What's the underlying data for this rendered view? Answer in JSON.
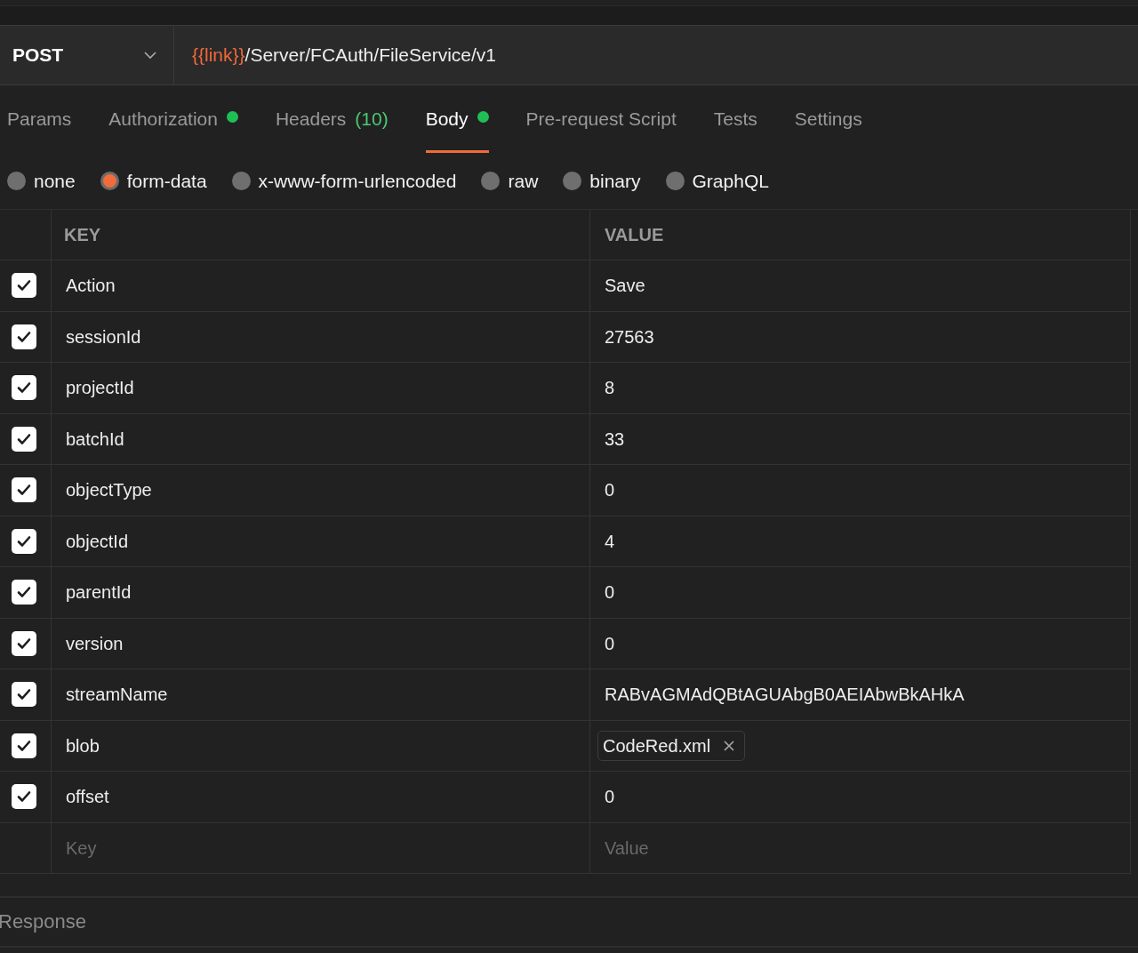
{
  "request": {
    "method": "POST",
    "url_variable": "{{link}}",
    "url_path": "/Server/FCAuth/FileService/v1"
  },
  "tabs": [
    {
      "label": "Params",
      "selected": false,
      "dot": false
    },
    {
      "label": "Authorization",
      "selected": false,
      "dot": true
    },
    {
      "label": "Headers",
      "count": "(10)",
      "selected": false,
      "dot": false
    },
    {
      "label": "Body",
      "selected": true,
      "dot": true
    },
    {
      "label": "Pre-request Script",
      "selected": false,
      "dot": false
    },
    {
      "label": "Tests",
      "selected": false,
      "dot": false
    },
    {
      "label": "Settings",
      "selected": false,
      "dot": false
    }
  ],
  "body_types": [
    {
      "label": "none",
      "selected": false
    },
    {
      "label": "form-data",
      "selected": true
    },
    {
      "label": "x-www-form-urlencoded",
      "selected": false
    },
    {
      "label": "raw",
      "selected": false
    },
    {
      "label": "binary",
      "selected": false
    },
    {
      "label": "GraphQL",
      "selected": false
    }
  ],
  "table": {
    "columns": [
      "KEY",
      "VALUE"
    ],
    "rows": [
      {
        "checked": true,
        "key": "Action",
        "kind": "text",
        "value": "Save"
      },
      {
        "checked": true,
        "key": "sessionId",
        "kind": "text",
        "value": "27563"
      },
      {
        "checked": true,
        "key": "projectId",
        "kind": "text",
        "value": "8"
      },
      {
        "checked": true,
        "key": "batchId",
        "kind": "text",
        "value": "33"
      },
      {
        "checked": true,
        "key": "objectType",
        "kind": "text",
        "value": "0"
      },
      {
        "checked": true,
        "key": "objectId",
        "kind": "text",
        "value": "4"
      },
      {
        "checked": true,
        "key": "parentId",
        "kind": "text",
        "value": "0"
      },
      {
        "checked": true,
        "key": "version",
        "kind": "text",
        "value": "0"
      },
      {
        "checked": true,
        "key": "streamName",
        "kind": "text",
        "value": "RABvAGMAdQBtAGUAbgB0AEIAbwBkAHkA"
      },
      {
        "checked": true,
        "key": "blob",
        "kind": "file",
        "value": "CodeRed.xml"
      },
      {
        "checked": true,
        "key": "offset",
        "kind": "text",
        "value": "0"
      }
    ],
    "new_row": {
      "key_placeholder": "Key",
      "value_placeholder": "Value"
    }
  },
  "response": {
    "title": "Response"
  }
}
